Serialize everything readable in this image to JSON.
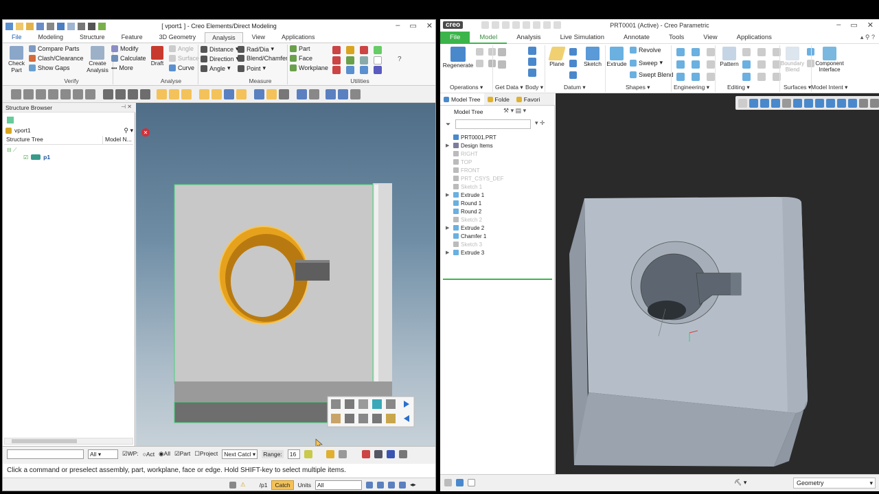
{
  "left_window": {
    "title": "[ vport1 ] - Creo Elements/Direct Modeling",
    "tabs": [
      "File",
      "Modeling",
      "Structure",
      "Feature",
      "3D Geometry",
      "Analysis",
      "View",
      "Applications"
    ],
    "active_tab": "Analysis",
    "ribbon": {
      "verify": {
        "label": "Verify",
        "check_part": "Check Part",
        "compare_parts": "Compare Parts",
        "clash": "Clash/Clearance",
        "show_gaps": "Show Gaps",
        "create_analysis": "Create Analysis"
      },
      "analyse": {
        "label": "Analyse",
        "modify": "Modify",
        "calculate": "Calculate",
        "more": "More",
        "draft": "Draft",
        "angle": "Angle",
        "surface": "Surface",
        "curve": "Curve"
      },
      "measure": {
        "label": "Measure",
        "distance": "Distance",
        "direction": "Direction",
        "angle": "Angle",
        "rad_dia": "Rad/Dia",
        "blend_chamfer": "Blend/Chamfer",
        "point": "Point"
      },
      "utilities": {
        "label": "Utilities",
        "part": "Part",
        "face": "Face",
        "workplane": "Workplane"
      }
    },
    "structure_browser": {
      "title": "Structure Browser",
      "vport": "vport1",
      "col_tree": "Structure Tree",
      "col_model": "Model N...",
      "part": "p1"
    },
    "status": {
      "filter_all": "All",
      "wp": "WP:",
      "act": "Act",
      "all": "All",
      "part": "Part",
      "project": "Project",
      "next_catch": "Next Catcl",
      "range_label": "Range:",
      "range_value": "16"
    },
    "message": "Click a command or preselect assembly, part, workplane, face or edge. Hold SHIFT-key to select multiple items.",
    "bottom": {
      "path": "/p1",
      "catch": "Catch",
      "units": "Units",
      "units_value": "All"
    }
  },
  "right_window": {
    "logo": "creo",
    "title": "PRT0001 (Active) - Creo Parametric",
    "tabs": [
      "File",
      "Model",
      "Analysis",
      "Live Simulation",
      "Annotate",
      "Tools",
      "View",
      "Applications"
    ],
    "active_tab": "Model",
    "ribbon": {
      "regenerate": "Regenerate",
      "operations": "Operations",
      "get_data": "Get Data",
      "body": "Body",
      "plane": "Plane",
      "sketch": "Sketch",
      "datum": "Datum",
      "extrude": "Extrude",
      "revolve": "Revolve",
      "sweep": "Sweep",
      "swept_blend": "Swept Blend",
      "shapes": "Shapes",
      "engineering": "Engineering",
      "pattern": "Pattern",
      "editing": "Editing",
      "boundary_blend": "Boundary Blend",
      "surfaces": "Surfaces",
      "component_interface": "Component Interface",
      "model_intent": "Model Intent"
    },
    "model_tree": {
      "tabs": [
        "Model Tree",
        "Folde",
        "Favori"
      ],
      "header": "Model Tree",
      "items": [
        {
          "label": "PRT0001.PRT",
          "dim": false,
          "expand": false
        },
        {
          "label": "Design Items",
          "dim": false,
          "expand": true
        },
        {
          "label": "RIGHT",
          "dim": true,
          "expand": false
        },
        {
          "label": "TOP",
          "dim": true,
          "expand": false
        },
        {
          "label": "FRONT",
          "dim": true,
          "expand": false
        },
        {
          "label": "PRT_CSYS_DEF",
          "dim": true,
          "expand": false
        },
        {
          "label": "Sketch 1",
          "dim": true,
          "expand": false
        },
        {
          "label": "Extrude 1",
          "dim": false,
          "expand": true
        },
        {
          "label": "Round 1",
          "dim": false,
          "expand": false
        },
        {
          "label": "Round 2",
          "dim": false,
          "expand": false
        },
        {
          "label": "Sketch 2",
          "dim": true,
          "expand": false
        },
        {
          "label": "Extrude 2",
          "dim": false,
          "expand": true
        },
        {
          "label": "Chamfer 1",
          "dim": false,
          "expand": false
        },
        {
          "label": "Sketch 3",
          "dim": true,
          "expand": false
        },
        {
          "label": "Extrude 3",
          "dim": false,
          "expand": true
        }
      ]
    },
    "filter": "Geometry"
  },
  "colors": {
    "creo_green": "#3bb54a",
    "highlight_orange": "#e6a21c",
    "selection_green": "#4ccf7a",
    "catch_yellow": "#f3c25a"
  }
}
